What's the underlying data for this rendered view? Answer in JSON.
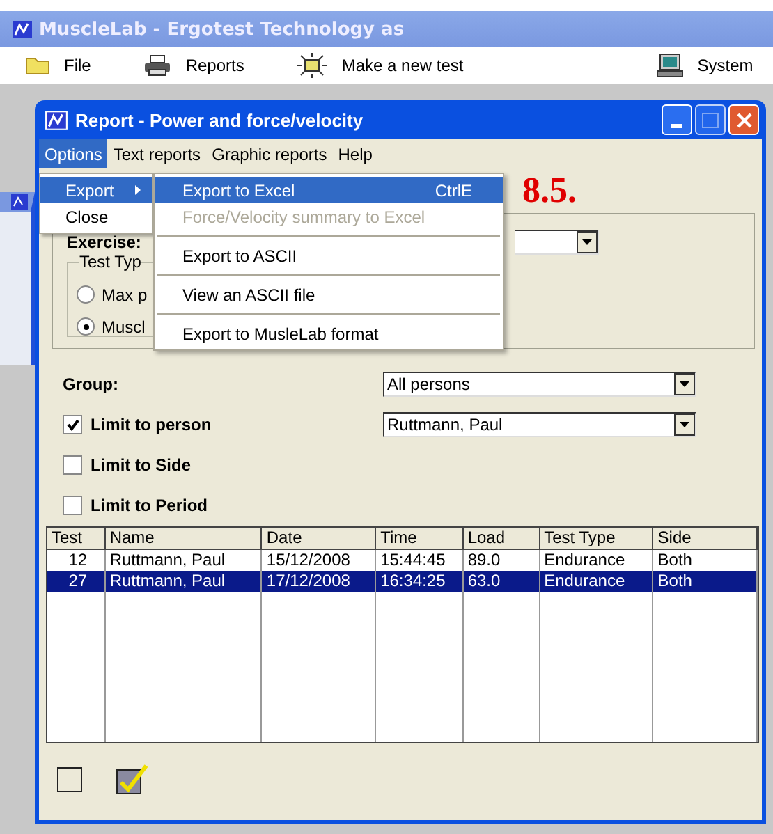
{
  "app_window": {
    "title": "MuscleLab - Ergotest Technology as"
  },
  "toolbar": [
    {
      "kind": "folder",
      "label": "File"
    },
    {
      "kind": "printer",
      "label": "Reports"
    },
    {
      "kind": "sun",
      "label": "Make a new test"
    },
    {
      "kind": "computer",
      "label": "System"
    }
  ],
  "report_window": {
    "title": "Report - Power and force/velocity"
  },
  "menu_bar": [
    {
      "label": "Options",
      "selected": true
    },
    {
      "label": "Text reports",
      "selected": false
    },
    {
      "label": "Graphic reports",
      "selected": false
    },
    {
      "label": "Help",
      "selected": false
    }
  ],
  "options_menu": [
    {
      "label": "Export",
      "selected": true,
      "submenu": true
    },
    {
      "label": "Close",
      "selected": false,
      "submenu": false
    }
  ],
  "export_submenu": [
    {
      "kind": "item",
      "label": "Export to Excel",
      "shortcut": "CtrlE",
      "selected": true,
      "disabled": false
    },
    {
      "kind": "item",
      "label": "Force/Velocity summary to Excel",
      "selected": false,
      "disabled": true
    },
    {
      "kind": "separator"
    },
    {
      "kind": "item",
      "label": "Export to ASCII",
      "selected": false,
      "disabled": false
    },
    {
      "kind": "separator"
    },
    {
      "kind": "item",
      "label": "View an ASCII file",
      "selected": false,
      "disabled": false
    },
    {
      "kind": "separator"
    },
    {
      "kind": "item",
      "label": "Export to MusleLab format",
      "selected": false,
      "disabled": false
    }
  ],
  "annotation": "8.5.",
  "exercise": {
    "label": "Exercise:"
  },
  "test_type": {
    "label": "Test Typ",
    "options": [
      {
        "label": "Max p",
        "selected": false
      },
      {
        "label": "Muscl",
        "selected": true
      }
    ]
  },
  "group": {
    "label": "Group:",
    "value": "All persons"
  },
  "filters": [
    {
      "label": "Limit to person",
      "checked": true,
      "value": "Ruttmann, Paul"
    },
    {
      "label": "Limit to Side",
      "checked": false
    },
    {
      "label": "Limit to Period",
      "checked": false
    }
  ],
  "table": {
    "columns": [
      "Test",
      "Name",
      "Date",
      "Time",
      "Load",
      "Test Type",
      "Side"
    ],
    "rows": [
      {
        "cells": [
          "12",
          "Ruttmann, Paul",
          "15/12/2008",
          "15:44:45",
          "89.0",
          "Endurance",
          "Both"
        ],
        "selected": false
      },
      {
        "cells": [
          "27",
          "Ruttmann, Paul",
          "17/12/2008",
          "16:34:25",
          "63.0",
          "Endurance",
          "Both"
        ],
        "selected": true
      }
    ]
  },
  "bottom_buttons": [
    {
      "kind": "blank"
    },
    {
      "kind": "tick"
    }
  ]
}
